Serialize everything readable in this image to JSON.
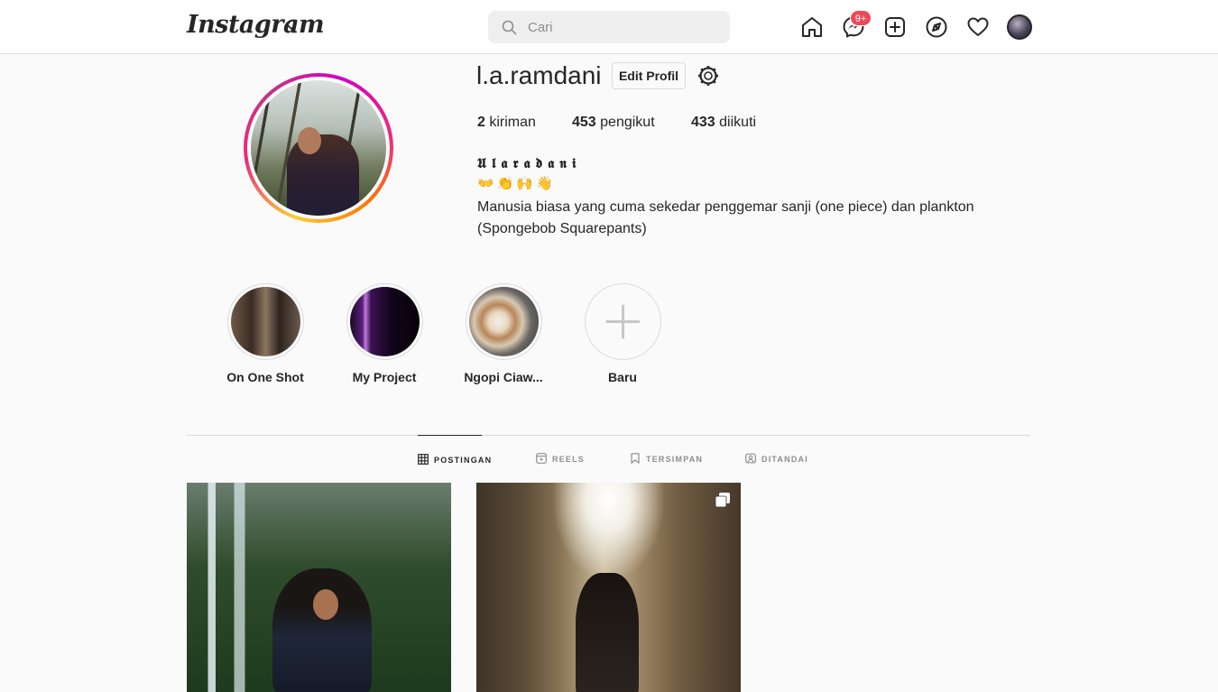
{
  "nav": {
    "logo_text": "Instagram",
    "search_placeholder": "Cari",
    "messages_badge": "9+",
    "icons": [
      "home-icon",
      "messenger-icon",
      "new-post-icon",
      "explore-icon",
      "activity-heart-icon",
      "profile-avatar"
    ]
  },
  "profile": {
    "username": "l.a.ramdani",
    "edit_label": "Edit Profil",
    "stats": [
      {
        "count": "2",
        "label": "kiriman"
      },
      {
        "count": "453",
        "label": "pengikut"
      },
      {
        "count": "433",
        "label": "diikuti"
      }
    ],
    "full_name": "𝖀𝖑𝖆𝖗𝖆𝖉𝖆𝖓𝖎",
    "emoji_line": "👐👏🙌👋",
    "bio": "Manusia biasa yang cuma sekedar penggemar sanji (one piece) dan plankton (Spongebob Squarepants)"
  },
  "highlights": [
    {
      "label": "On One Shot"
    },
    {
      "label": "My Project"
    },
    {
      "label": "Ngopi Ciaw..."
    },
    {
      "label": "Baru"
    }
  ],
  "tabs": [
    {
      "label": "POSTINGAN",
      "active": true
    },
    {
      "label": "REELS",
      "active": false
    },
    {
      "label": "TERSIMPAN",
      "active": false
    },
    {
      "label": "DITANDAI",
      "active": false
    }
  ],
  "colors": {
    "badge": "#ed4956",
    "story_ring_start": "#f9ce34",
    "story_ring_mid": "#ee2a7b",
    "story_ring_end": "#c13584",
    "border": "#dbdbdb",
    "text": "#262626",
    "muted": "#8e8e8e"
  }
}
